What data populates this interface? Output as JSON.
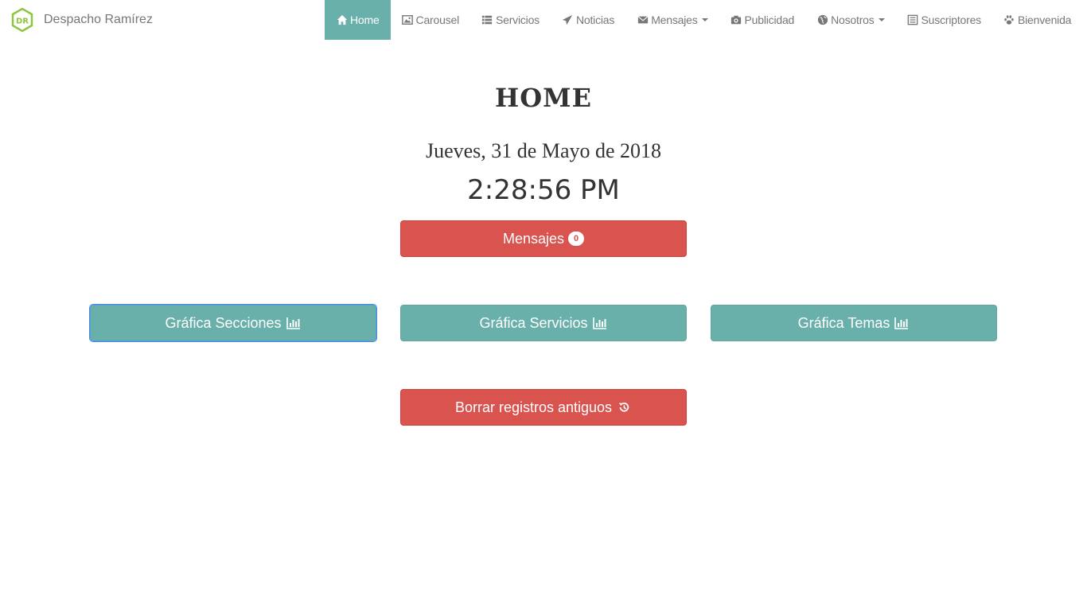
{
  "brand": {
    "name": "Despacho Ramírez",
    "logo_text": "DR"
  },
  "nav": {
    "items": [
      {
        "label": "Home",
        "icon": "home-icon"
      },
      {
        "label": "Carousel",
        "icon": "picture-icon"
      },
      {
        "label": "Servicios",
        "icon": "list-icon"
      },
      {
        "label": "Noticias",
        "icon": "send-icon"
      },
      {
        "label": "Mensajes",
        "icon": "envelope-icon"
      },
      {
        "label": "Publicidad",
        "icon": "camera-icon"
      },
      {
        "label": "Nosotros",
        "icon": "globe-icon"
      },
      {
        "label": "Suscriptores",
        "icon": "list-alt-icon"
      },
      {
        "label": "Bienvenida",
        "icon": "paw-icon"
      }
    ]
  },
  "main": {
    "title": "HOME",
    "date": "Jueves, 31 de Mayo de 2018",
    "time": "2:28:56 PM",
    "messages_button": {
      "label": "Mensajes",
      "count": "0"
    },
    "chart_buttons": [
      {
        "label": "Gráfica Secciones",
        "icon": "stats-icon"
      },
      {
        "label": "Gráfica Servicios",
        "icon": "stats-icon"
      },
      {
        "label": "Gráfica Temas",
        "icon": "stats-icon"
      }
    ],
    "delete_button": {
      "label": "Borrar registros antiguos",
      "icon": "history-icon"
    }
  },
  "colors": {
    "accent": "#69b0aa",
    "danger": "#d9534f",
    "logo": "#8dc63f"
  }
}
